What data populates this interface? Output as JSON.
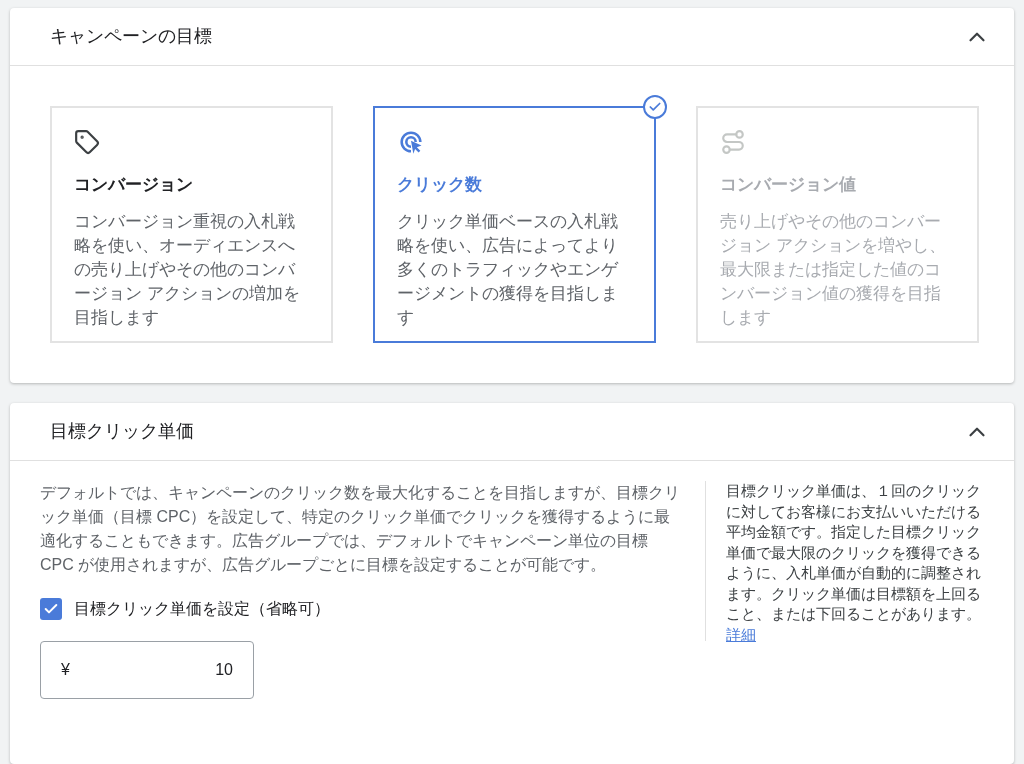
{
  "goal_panel": {
    "title": "キャンペーンの目標",
    "expanded": true,
    "options": [
      {
        "kind": "tag",
        "title": "コンバージョン",
        "description": "コンバージョン重視の入札戦略を使い、オーディエンスへの売り上げやその他のコンバージョン アクションの増加を目指します",
        "selected": false,
        "disabled": false
      },
      {
        "kind": "click",
        "title": "クリック数",
        "description": "クリック単価ベースの入札戦略を使い、広告によってより多くのトラフィックやエンゲージメントの獲得を目指します",
        "selected": true,
        "disabled": false
      },
      {
        "kind": "route",
        "title": "コンバージョン値",
        "description": "売り上げやその他のコンバージョン アクションを増やし、最大限または指定した値のコンバージョン値の獲得を目指します",
        "selected": false,
        "disabled": true
      }
    ]
  },
  "cpc_panel": {
    "title": "目標クリック単価",
    "expanded": true,
    "description": "デフォルトでは、キャンペーンのクリック数を最大化することを目指しますが、目標クリック単価（目標 CPC）を設定して、特定のクリック単価でクリックを獲得するように最適化することもできます。広告グループでは、デフォルトでキャンペーン単位の目標 CPC が使用されますが、広告グループごとに目標を設定することが可能です。",
    "checkbox": {
      "label": "目標クリック単価を設定（省略可）",
      "checked": true
    },
    "amount": {
      "currency": "¥",
      "value": "10"
    },
    "help": {
      "text": "目標クリック単価は、１回のクリックに対してお客様にお支払いいただける平均金額です。指定した目標クリック単価で最大限のクリックを獲得できるように、入札単価が自動的に調整されます。クリック単価は目標額を上回ること、または下回ることがあります。",
      "link": "詳細"
    }
  }
}
